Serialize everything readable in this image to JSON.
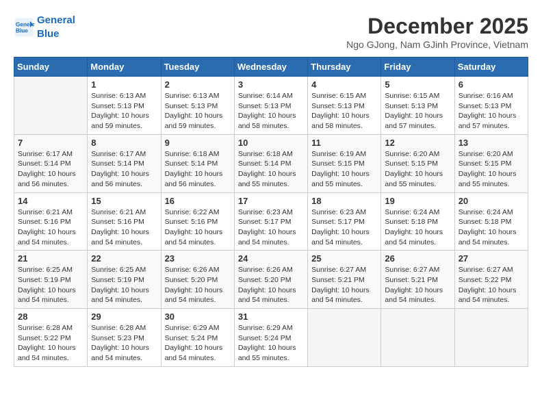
{
  "header": {
    "logo_line1": "General",
    "logo_line2": "Blue",
    "month_title": "December 2025",
    "location": "Ngo GJong, Nam GJinh Province, Vietnam"
  },
  "weekdays": [
    "Sunday",
    "Monday",
    "Tuesday",
    "Wednesday",
    "Thursday",
    "Friday",
    "Saturday"
  ],
  "weeks": [
    [
      {
        "day": "",
        "info": ""
      },
      {
        "day": "1",
        "info": "Sunrise: 6:13 AM\nSunset: 5:13 PM\nDaylight: 10 hours\nand 59 minutes."
      },
      {
        "day": "2",
        "info": "Sunrise: 6:13 AM\nSunset: 5:13 PM\nDaylight: 10 hours\nand 59 minutes."
      },
      {
        "day": "3",
        "info": "Sunrise: 6:14 AM\nSunset: 5:13 PM\nDaylight: 10 hours\nand 58 minutes."
      },
      {
        "day": "4",
        "info": "Sunrise: 6:15 AM\nSunset: 5:13 PM\nDaylight: 10 hours\nand 58 minutes."
      },
      {
        "day": "5",
        "info": "Sunrise: 6:15 AM\nSunset: 5:13 PM\nDaylight: 10 hours\nand 57 minutes."
      },
      {
        "day": "6",
        "info": "Sunrise: 6:16 AM\nSunset: 5:13 PM\nDaylight: 10 hours\nand 57 minutes."
      }
    ],
    [
      {
        "day": "7",
        "info": "Sunrise: 6:17 AM\nSunset: 5:14 PM\nDaylight: 10 hours\nand 56 minutes."
      },
      {
        "day": "8",
        "info": "Sunrise: 6:17 AM\nSunset: 5:14 PM\nDaylight: 10 hours\nand 56 minutes."
      },
      {
        "day": "9",
        "info": "Sunrise: 6:18 AM\nSunset: 5:14 PM\nDaylight: 10 hours\nand 56 minutes."
      },
      {
        "day": "10",
        "info": "Sunrise: 6:18 AM\nSunset: 5:14 PM\nDaylight: 10 hours\nand 55 minutes."
      },
      {
        "day": "11",
        "info": "Sunrise: 6:19 AM\nSunset: 5:15 PM\nDaylight: 10 hours\nand 55 minutes."
      },
      {
        "day": "12",
        "info": "Sunrise: 6:20 AM\nSunset: 5:15 PM\nDaylight: 10 hours\nand 55 minutes."
      },
      {
        "day": "13",
        "info": "Sunrise: 6:20 AM\nSunset: 5:15 PM\nDaylight: 10 hours\nand 55 minutes."
      }
    ],
    [
      {
        "day": "14",
        "info": "Sunrise: 6:21 AM\nSunset: 5:16 PM\nDaylight: 10 hours\nand 54 minutes."
      },
      {
        "day": "15",
        "info": "Sunrise: 6:21 AM\nSunset: 5:16 PM\nDaylight: 10 hours\nand 54 minutes."
      },
      {
        "day": "16",
        "info": "Sunrise: 6:22 AM\nSunset: 5:16 PM\nDaylight: 10 hours\nand 54 minutes."
      },
      {
        "day": "17",
        "info": "Sunrise: 6:23 AM\nSunset: 5:17 PM\nDaylight: 10 hours\nand 54 minutes."
      },
      {
        "day": "18",
        "info": "Sunrise: 6:23 AM\nSunset: 5:17 PM\nDaylight: 10 hours\nand 54 minutes."
      },
      {
        "day": "19",
        "info": "Sunrise: 6:24 AM\nSunset: 5:18 PM\nDaylight: 10 hours\nand 54 minutes."
      },
      {
        "day": "20",
        "info": "Sunrise: 6:24 AM\nSunset: 5:18 PM\nDaylight: 10 hours\nand 54 minutes."
      }
    ],
    [
      {
        "day": "21",
        "info": "Sunrise: 6:25 AM\nSunset: 5:19 PM\nDaylight: 10 hours\nand 54 minutes."
      },
      {
        "day": "22",
        "info": "Sunrise: 6:25 AM\nSunset: 5:19 PM\nDaylight: 10 hours\nand 54 minutes."
      },
      {
        "day": "23",
        "info": "Sunrise: 6:26 AM\nSunset: 5:20 PM\nDaylight: 10 hours\nand 54 minutes."
      },
      {
        "day": "24",
        "info": "Sunrise: 6:26 AM\nSunset: 5:20 PM\nDaylight: 10 hours\nand 54 minutes."
      },
      {
        "day": "25",
        "info": "Sunrise: 6:27 AM\nSunset: 5:21 PM\nDaylight: 10 hours\nand 54 minutes."
      },
      {
        "day": "26",
        "info": "Sunrise: 6:27 AM\nSunset: 5:21 PM\nDaylight: 10 hours\nand 54 minutes."
      },
      {
        "day": "27",
        "info": "Sunrise: 6:27 AM\nSunset: 5:22 PM\nDaylight: 10 hours\nand 54 minutes."
      }
    ],
    [
      {
        "day": "28",
        "info": "Sunrise: 6:28 AM\nSunset: 5:22 PM\nDaylight: 10 hours\nand 54 minutes."
      },
      {
        "day": "29",
        "info": "Sunrise: 6:28 AM\nSunset: 5:23 PM\nDaylight: 10 hours\nand 54 minutes."
      },
      {
        "day": "30",
        "info": "Sunrise: 6:29 AM\nSunset: 5:24 PM\nDaylight: 10 hours\nand 54 minutes."
      },
      {
        "day": "31",
        "info": "Sunrise: 6:29 AM\nSunset: 5:24 PM\nDaylight: 10 hours\nand 55 minutes."
      },
      {
        "day": "",
        "info": ""
      },
      {
        "day": "",
        "info": ""
      },
      {
        "day": "",
        "info": ""
      }
    ]
  ]
}
